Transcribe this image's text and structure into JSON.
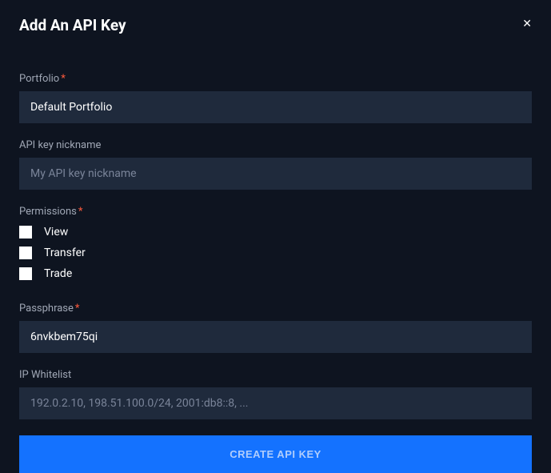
{
  "modal": {
    "title": "Add An API Key"
  },
  "portfolio": {
    "label": "Portfolio",
    "value": "Default Portfolio"
  },
  "nickname": {
    "label": "API key nickname",
    "placeholder": "My API key nickname"
  },
  "permissions": {
    "label": "Permissions",
    "options": {
      "view": "View",
      "transfer": "Transfer",
      "trade": "Trade"
    }
  },
  "passphrase": {
    "label": "Passphrase",
    "value": "6nvkbem75qi"
  },
  "whitelist": {
    "label": "IP Whitelist",
    "placeholder": "192.0.2.10, 198.51.100.0/24, 2001:db8::8, ..."
  },
  "submit": {
    "label": "CREATE API KEY"
  }
}
